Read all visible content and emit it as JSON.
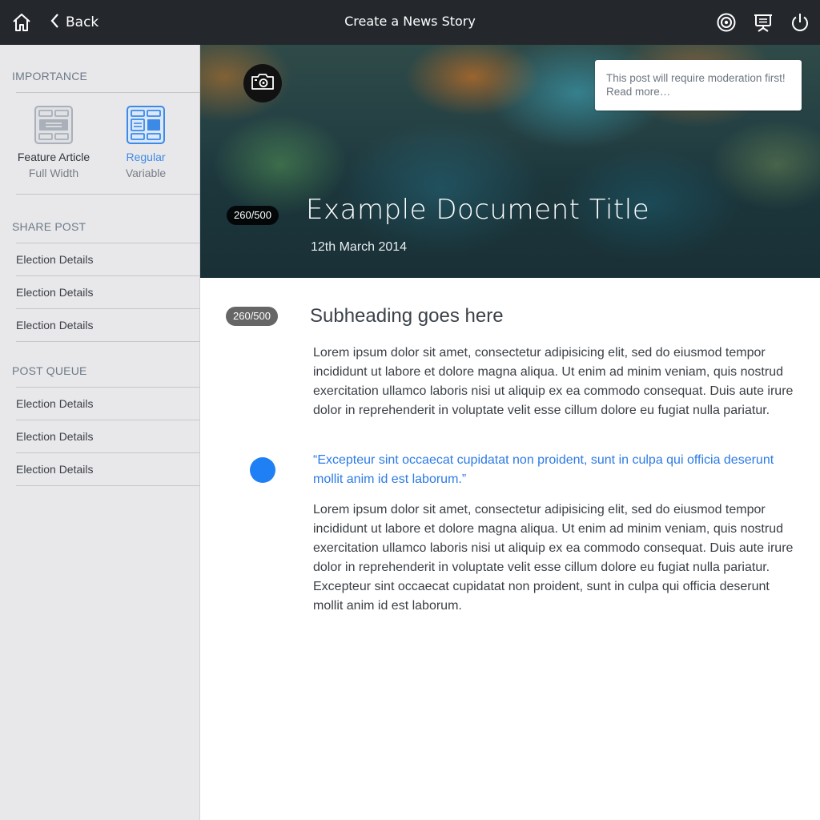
{
  "header": {
    "title": "Create a News Story",
    "back_label": "Back",
    "icons": [
      "home-icon",
      "chevron-left-icon",
      "target-icon",
      "presentation-icon",
      "power-icon"
    ]
  },
  "sidebar": {
    "importance": {
      "title": "IMPORTANCE",
      "options": [
        {
          "label": "Feature Article",
          "sub": "Full Width",
          "selected": false
        },
        {
          "label": "Regular",
          "sub": "Variable",
          "selected": true
        }
      ]
    },
    "share": {
      "title": "SHARE POST",
      "items": [
        "Election Details",
        "Election Details",
        "Election Details"
      ]
    },
    "queue": {
      "title": "POST QUEUE",
      "items": [
        "Election Details",
        "Election Details",
        "Election Details"
      ]
    }
  },
  "hero": {
    "moderation_notice": "This post will require moderation first! Read more…",
    "counter": "260/500",
    "title": "Example Document Title",
    "date": "12th March 2014"
  },
  "content": {
    "counter": "260/500",
    "subheading": "Subheading goes here",
    "paragraph1": "Lorem ipsum dolor sit amet, consectetur adipisicing elit, sed do eiusmod tempor incididunt ut labore et dolore magna aliqua. Ut enim ad minim veniam, quis nostrud exercitation ullamco laboris nisi ut aliquip ex ea commodo consequat. Duis aute irure dolor in reprehenderit in voluptate velit esse cillum dolore eu fugiat nulla pariatur.",
    "quote": "“Excepteur sint occaecat cupidatat non proident, sunt in culpa qui officia deserunt mollit anim id est laborum.”",
    "paragraph2": "Lorem ipsum dolor sit amet, consectetur adipisicing elit, sed do eiusmod tempor incididunt ut labore et dolore magna aliqua. Ut enim ad minim veniam, quis nostrud exercitation ullamco laboris nisi ut aliquip ex ea commodo consequat. Duis aute irure dolor in reprehenderit in voluptate velit esse cillum dolore eu fugiat nulla pariatur. Excepteur sint occaecat cupidatat non proident, sunt in culpa qui officia deserunt mollit anim id est laborum."
  },
  "colors": {
    "topbar": "#24282d",
    "sidebar": "#e8e8ea",
    "accent": "#2c7be5",
    "quote": "#2c7be5",
    "dot": "#1f80f5"
  }
}
